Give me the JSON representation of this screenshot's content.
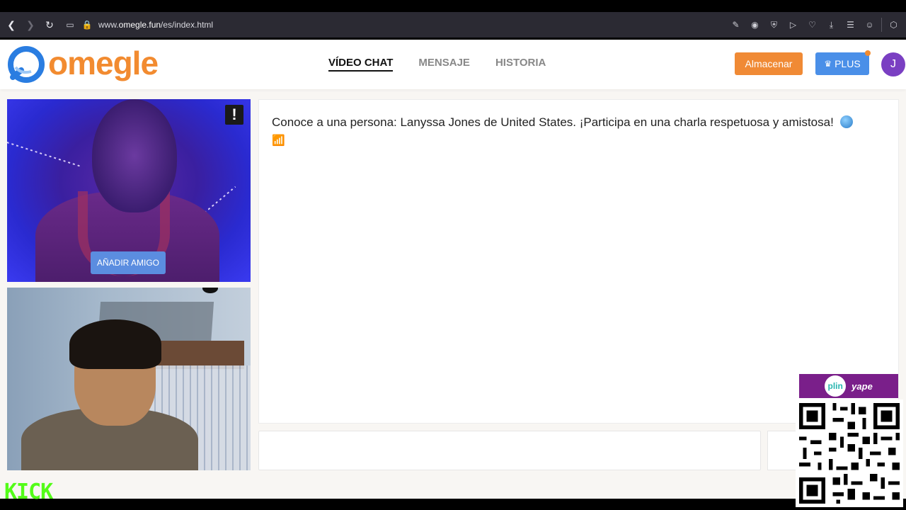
{
  "browser": {
    "url_prefix": "www.",
    "url_domain": "omegle.fun",
    "url_path": "/es/index.html"
  },
  "header": {
    "logo_text": "omegle",
    "tabs": [
      {
        "label": "VÍDEO CHAT",
        "active": true
      },
      {
        "label": "MENSAJE",
        "active": false
      },
      {
        "label": "HISTORIA",
        "active": false
      }
    ],
    "store_label": "Almacenar",
    "plus_label": "PLUS",
    "avatar_initial": "J"
  },
  "video": {
    "add_friend_label": "AÑADIR AMIGO",
    "report_glyph": "!"
  },
  "chat": {
    "message": "Conoce a una persona: Lanyssa Jones de United States. ¡Participa en una charla respetuosa y amistosa!"
  },
  "overlay": {
    "kick_text": "KICK",
    "plin_text": "plin",
    "yape_text": "yape"
  },
  "colors": {
    "brand_orange": "#f28b30",
    "plus_blue": "#4a8fe8",
    "kick_green": "#53fc18",
    "avatar_purple": "#7a3fc2"
  }
}
